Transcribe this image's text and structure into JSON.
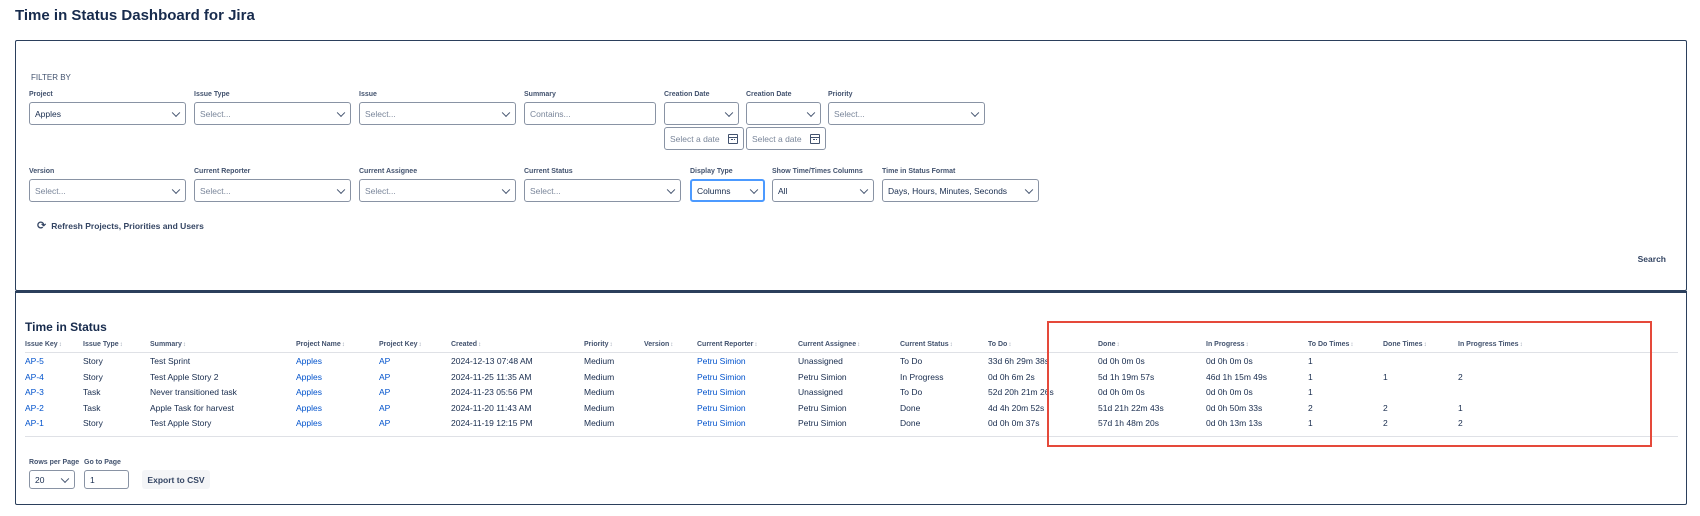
{
  "page": {
    "title": "Time in Status Dashboard for Jira"
  },
  "filters": {
    "heading": "FILTER BY",
    "project": {
      "label": "Project",
      "value": "Apples"
    },
    "issue_type": {
      "label": "Issue Type",
      "placeholder": "Select..."
    },
    "issue": {
      "label": "Issue",
      "placeholder": "Select..."
    },
    "summary": {
      "label": "Summary",
      "placeholder": "Contains..."
    },
    "creation_date_from": {
      "label": "Creation Date",
      "date_placeholder": "Select a date"
    },
    "creation_date_to": {
      "label": "Creation Date",
      "date_placeholder": "Select a date"
    },
    "priority": {
      "label": "Priority",
      "placeholder": "Select..."
    },
    "version": {
      "label": "Version",
      "placeholder": "Select..."
    },
    "current_reporter": {
      "label": "Current Reporter",
      "placeholder": "Select..."
    },
    "current_assignee": {
      "label": "Current Assignee",
      "placeholder": "Select..."
    },
    "current_status": {
      "label": "Current Status",
      "placeholder": "Select..."
    },
    "display_type": {
      "label": "Display Type",
      "value": "Columns"
    },
    "show_columns": {
      "label": "Show Time/Times Columns",
      "value": "All"
    },
    "time_format": {
      "label": "Time in Status Format",
      "value": "Days, Hours, Minutes, Seconds"
    },
    "refresh_label": "Refresh Projects, Priorities and Users",
    "search_label": "Search"
  },
  "results": {
    "title": "Time in Status",
    "columns": [
      "Issue Key",
      "Issue Type",
      "Summary",
      "Project Name",
      "Project Key",
      "Created",
      "Priority",
      "Version",
      "Current Reporter",
      "Current Assignee",
      "Current Status",
      "To Do",
      "Done",
      "In Progress",
      "To Do Times",
      "Done Times",
      "In Progress Times"
    ],
    "rows": [
      [
        "AP-5",
        "Story",
        "Test Sprint",
        "Apples",
        "AP",
        "2024-12-13 07:48 AM",
        "Medium",
        "",
        "Petru Simion",
        "Unassigned",
        "To Do",
        "33d 6h 29m 38s",
        "0d 0h 0m 0s",
        "0d 0h 0m 0s",
        "1",
        "",
        ""
      ],
      [
        "AP-4",
        "Story",
        "Test Apple Story 2",
        "Apples",
        "AP",
        "2024-11-25 11:35 AM",
        "Medium",
        "",
        "Petru Simion",
        "Petru Simion",
        "In Progress",
        "0d 0h 6m 2s",
        "5d 1h 19m 57s",
        "46d 1h 15m 49s",
        "1",
        "1",
        "2"
      ],
      [
        "AP-3",
        "Task",
        "Never transitioned task",
        "Apples",
        "AP",
        "2024-11-23 05:56 PM",
        "Medium",
        "",
        "Petru Simion",
        "Unassigned",
        "To Do",
        "52d 20h 21m 26s",
        "0d 0h 0m 0s",
        "0d 0h 0m 0s",
        "1",
        "",
        ""
      ],
      [
        "AP-2",
        "Task",
        "Apple Task for harvest",
        "Apples",
        "AP",
        "2024-11-20 11:43 AM",
        "Medium",
        "",
        "Petru Simion",
        "Petru Simion",
        "Done",
        "4d 4h 20m 52s",
        "51d 21h 22m 43s",
        "0d 0h 50m 33s",
        "2",
        "2",
        "1"
      ],
      [
        "AP-1",
        "Story",
        "Test Apple Story",
        "Apples",
        "AP",
        "2024-11-19 12:15 PM",
        "Medium",
        "",
        "Petru Simion",
        "Petru Simion",
        "Done",
        "0d 0h 0m 37s",
        "57d 1h 48m 20s",
        "0d 0h 13m 13s",
        "1",
        "2",
        "2"
      ]
    ]
  },
  "pagination": {
    "rows_per_page_label": "Rows per Page",
    "rows_per_page_value": "20",
    "go_to_page_label": "Go to Page",
    "go_to_page_value": "1",
    "export_label": "Export to CSV"
  },
  "colors": {
    "link": "#0052cc",
    "highlight": "#e5493a",
    "panel_border": "#2b3f5c"
  }
}
